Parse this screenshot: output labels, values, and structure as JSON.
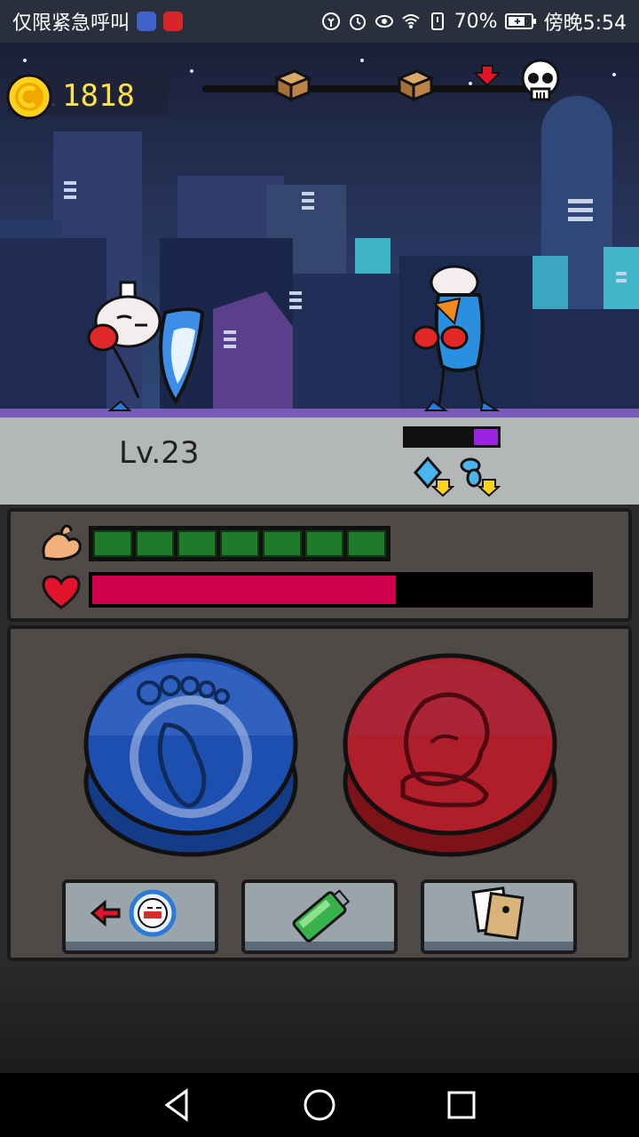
{
  "status_bar": {
    "carrier_text": "仅限紧急呼叫",
    "battery": "70%",
    "time": "傍晚5:54",
    "icons": [
      "music-app-icon",
      "netease-app-icon",
      "data-saver-icon",
      "alarm-icon",
      "eye-icon",
      "wifi-icon",
      "sim-icon",
      "battery-icon"
    ]
  },
  "hud": {
    "coins": "1818",
    "stage_progress": {
      "chests": 2,
      "marker": "red-arrow-down-icon",
      "boss": "skull-icon"
    }
  },
  "battle": {
    "level_label": "Lv.23",
    "enemy_bar_fill": 0.26,
    "enemy_debuffs": [
      "defense-down-icon",
      "speed-down-icon"
    ],
    "colors": {
      "enemy_bar": "#9b22e0"
    }
  },
  "player_stats": {
    "stamina_segments": 7,
    "hp_fraction": 0.61,
    "colors": {
      "stamina": "#1f7a2c",
      "hp": "#d0004a"
    }
  },
  "controls": {
    "left_button": "dodge-foot-button",
    "right_button": "punch-glove-button",
    "tools": [
      "switch-fighter-button",
      "item-battery-button",
      "cards-button"
    ],
    "colors": {
      "left": "#1d4fb0",
      "right": "#b01e2a"
    }
  },
  "nav_bar": [
    "back-nav-button",
    "home-nav-button",
    "recents-nav-button"
  ]
}
